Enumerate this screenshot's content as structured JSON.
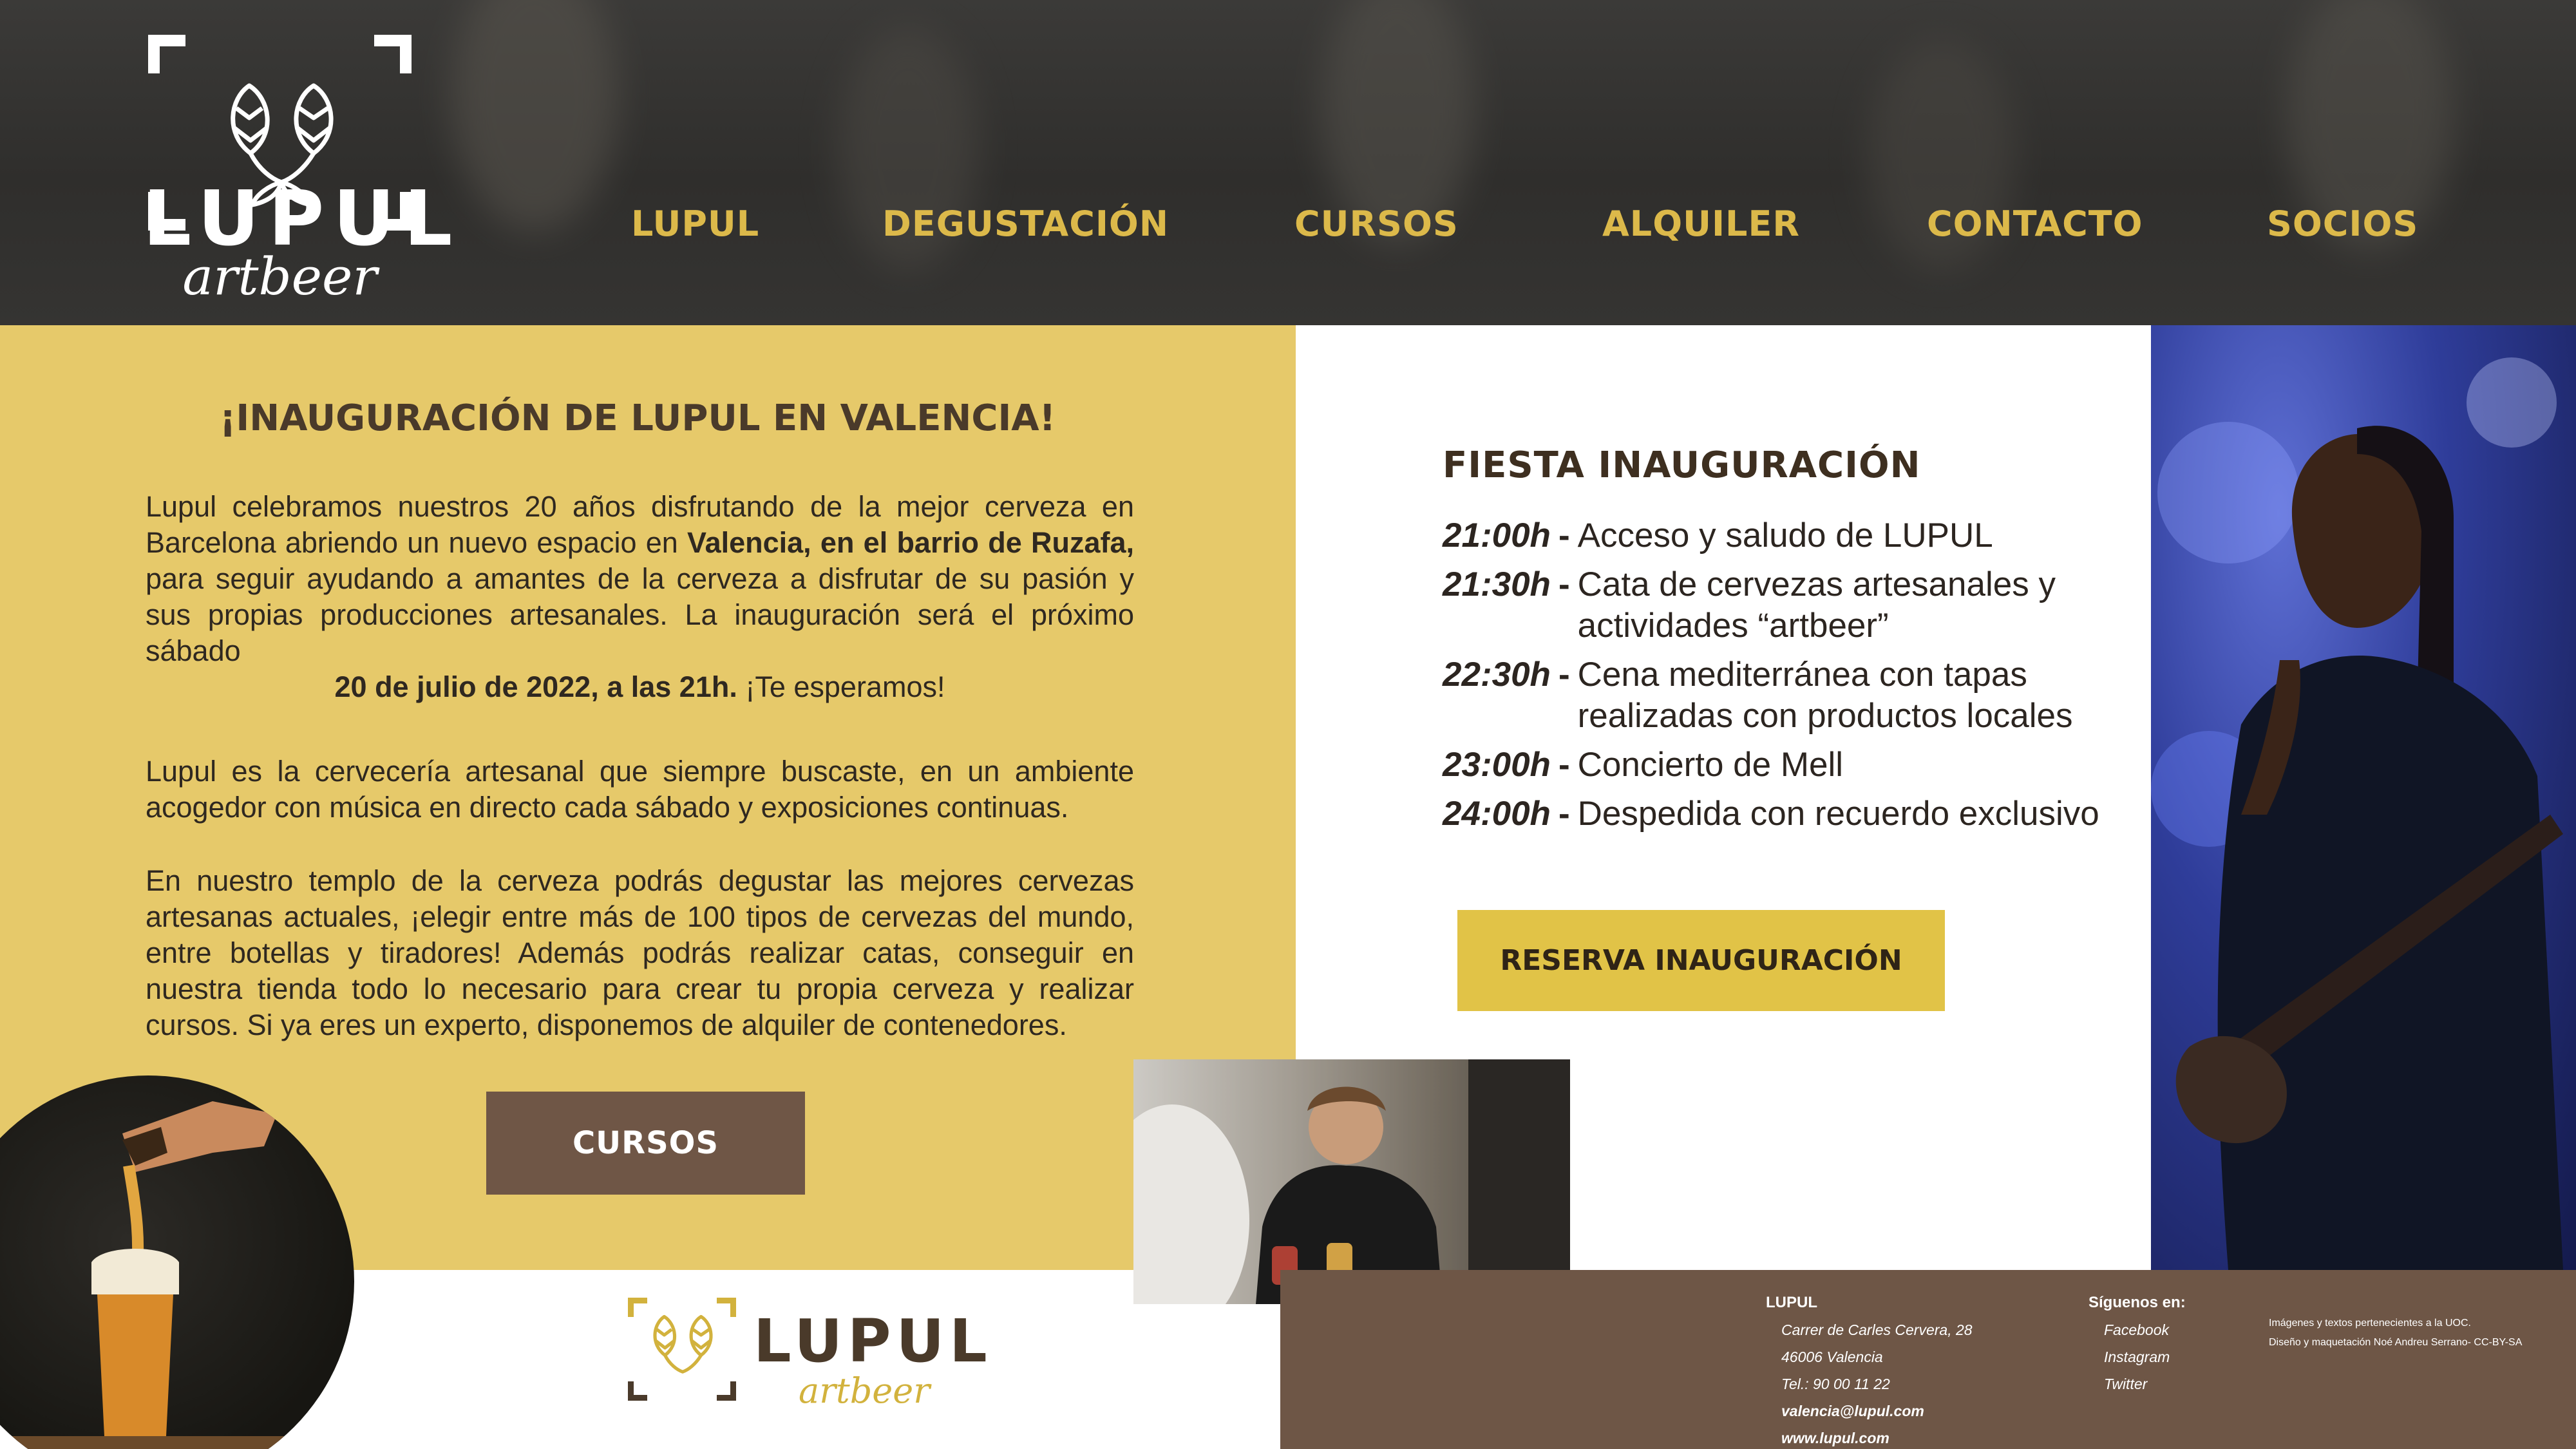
{
  "brand": {
    "name": "LUPUL",
    "tagline": "artbeer"
  },
  "nav": [
    "LUPUL",
    "DEGUSTACIÓN",
    "CURSOS",
    "ALQUILER",
    "CONTACTO",
    "SOCIOS"
  ],
  "intro": {
    "title": "¡INAUGURACIÓN DE LUPUL EN VALENCIA!",
    "p1_a": "Lupul celebramos nuestros 20 años disfrutando de la mejor cerveza en Barcelona abriendo un nuevo espacio en ",
    "p1_bold": "Valencia, en el barrio de Ruzafa,",
    "p1_b": " para seguir ayudando a amantes de la cerveza a disfrutar de su pasión y sus propias producciones artesanales. La inauguración será el próximo sábado",
    "p1_date": "20 de julio de 2022, a las 21h.",
    "p1_end": " ¡Te esperamos!",
    "p2": "Lupul es la cervecería artesanal que siempre buscaste, en un ambiente acogedor con música en directo cada sábado y exposiciones continuas.",
    "p3": "En nuestro templo de la cerveza podrás degustar las mejores cervezas artesanas actuales, ¡elegir entre más de 100 tipos de cervezas del mundo, entre botellas y tiradores! Además podrás realizar catas, conseguir en nuestra tienda todo lo necesario para crear tu propia cerveza y realizar cursos. Si ya eres un experto, disponemos de alquiler de contenedores.",
    "cta": "CURSOS"
  },
  "fiesta": {
    "title": "FIESTA INAUGURACIÓN",
    "schedule": [
      {
        "time": "21:00h",
        "desc": "Acceso y saludo de LUPUL"
      },
      {
        "time": "21:30h",
        "desc": "Cata de cervezas artesanales y actividades “artbeer”"
      },
      {
        "time": "22:30h",
        "desc": "Cena mediterránea con tapas realizadas con productos locales"
      },
      {
        "time": "23:00h",
        "desc": "Concierto de Mell"
      },
      {
        "time": "24:00h",
        "desc": "Despedida con recuerdo exclusivo"
      }
    ],
    "cta": "RESERVA INAUGURACIÓN"
  },
  "footer": {
    "col1": {
      "head": "LUPUL",
      "address": "Carrer de Carles Cervera, 28",
      "city": "46006 Valencia",
      "phone": "Tel.: 90 00 11 22",
      "email": "valencia@lupul.com",
      "web": "www.lupul.com"
    },
    "col2": {
      "head": "Síguenos en:",
      "links": [
        "Facebook",
        "Instagram",
        "Twitter"
      ]
    },
    "credits1": "Imágenes y textos pertenecientes a la UOC.",
    "credits2": "Diseño y maquetación Noé Andreu Serrano- CC-BY-SA"
  },
  "colors": {
    "yellow": "#e6c96a",
    "gold": "#dcb94a",
    "brown": "#6e5646",
    "header": "#2f2e2c"
  },
  "icons": [
    "hops-icon"
  ]
}
